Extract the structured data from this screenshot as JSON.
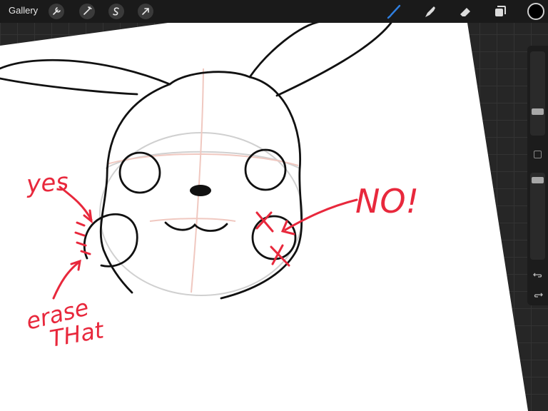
{
  "topbar": {
    "gallery_label": "Gallery",
    "tools_left": [
      "wrench-icon",
      "magic-wand-icon",
      "selection-s-icon",
      "transform-arrow-icon"
    ],
    "tools_right": [
      "brush-icon",
      "smudge-icon",
      "eraser-icon",
      "layers-icon"
    ],
    "active_tool": "brush-icon",
    "active_color": "#000000",
    "accent_color": "#2f7fe0"
  },
  "sidebar": {
    "brush_size_level": 0.25,
    "opacity_level": 0.05,
    "modify_button": "modify-square-icon",
    "undo": "undo-icon",
    "redo": "redo-icon"
  },
  "annotations": {
    "yes": "yes",
    "no": "NO!",
    "erase_line1": "erase",
    "erase_line2": "THat",
    "annotation_color": "#e8283c"
  }
}
